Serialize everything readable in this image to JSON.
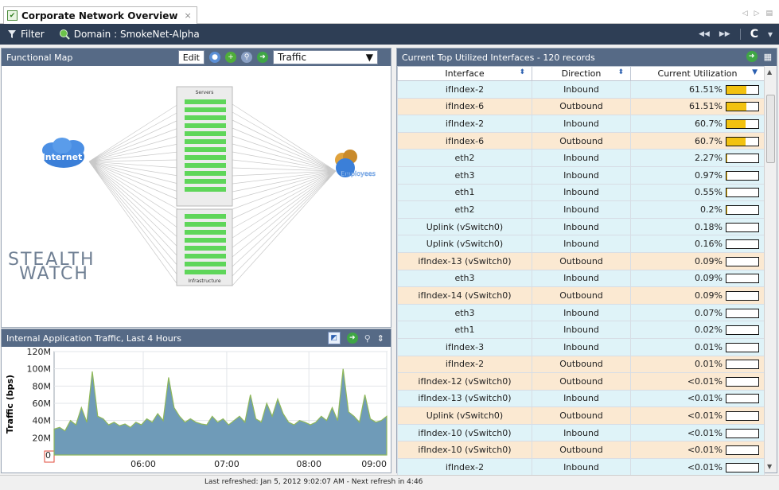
{
  "tab": {
    "title": "Corporate Network Overview",
    "close": "×",
    "nav_glyphs": [
      "◁",
      "▷",
      "▤"
    ]
  },
  "toolbar": {
    "filter_label": "Filter",
    "domain_label": "Domain : SmokeNet-Alpha",
    "nav_back": "◀◀",
    "nav_forward": "▶▶",
    "refresh": "C",
    "menu": "▾"
  },
  "functional_map": {
    "title": "Functional Map",
    "edit_label": "Edit",
    "view_select": "Traffic",
    "nodes": {
      "internet": "Internet",
      "employees": "Employees",
      "servers": "Servers",
      "infrastructure": "Infrastructure"
    },
    "logo": {
      "line1": "STEALTH",
      "line2": "WATCH"
    }
  },
  "traffic_chart": {
    "title": "Internal Application Traffic, Last 4 Hours",
    "colors": {
      "fill": "#6f9bb8",
      "spikes": "#8fb85a",
      "axis_box": "#e04a3a"
    }
  },
  "chart_data": {
    "type": "area",
    "ylabel": "Traffic (bps)",
    "yticks": [
      "0",
      "20M",
      "40M",
      "60M",
      "80M",
      "100M",
      "120M"
    ],
    "ylim": [
      0,
      120000000
    ],
    "xticks": [
      "06:00",
      "07:00",
      "08:00",
      "09:00"
    ],
    "series": [
      {
        "values": [
          30000000,
          32000000,
          28000000,
          40000000,
          35000000,
          55000000,
          38000000,
          97000000,
          45000000,
          42000000,
          35000000,
          38000000,
          34000000,
          36000000,
          32000000,
          38000000,
          35000000,
          42000000,
          38000000,
          48000000,
          40000000,
          90000000,
          55000000,
          45000000,
          38000000,
          42000000,
          38000000,
          36000000,
          35000000,
          45000000,
          38000000,
          42000000,
          35000000,
          40000000,
          45000000,
          38000000,
          70000000,
          42000000,
          38000000,
          60000000,
          45000000,
          65000000,
          48000000,
          38000000,
          35000000,
          40000000,
          38000000,
          35000000,
          38000000,
          45000000,
          40000000,
          55000000,
          40000000,
          100000000,
          50000000,
          45000000,
          38000000,
          70000000,
          42000000,
          38000000,
          40000000,
          45000000
        ]
      }
    ],
    "grid": true
  },
  "interfaces_table": {
    "title": "Current Top Utilized Interfaces - 120 records",
    "columns": [
      "Interface",
      "Direction",
      "Current Utilization"
    ],
    "rows": [
      {
        "interface": "ifIndex-2",
        "direction": "Inbound",
        "util": "61.51%",
        "pct": 61.51
      },
      {
        "interface": "ifIndex-6",
        "direction": "Outbound",
        "util": "61.51%",
        "pct": 61.51
      },
      {
        "interface": "ifIndex-2",
        "direction": "Inbound",
        "util": "60.7%",
        "pct": 60.7
      },
      {
        "interface": "ifIndex-6",
        "direction": "Outbound",
        "util": "60.7%",
        "pct": 60.7
      },
      {
        "interface": "eth2",
        "direction": "Inbound",
        "util": "2.27%",
        "pct": 2.27
      },
      {
        "interface": "eth3",
        "direction": "Inbound",
        "util": "0.97%",
        "pct": 0.97
      },
      {
        "interface": "eth1",
        "direction": "Inbound",
        "util": "0.55%",
        "pct": 0.55
      },
      {
        "interface": "eth2",
        "direction": "Inbound",
        "util": "0.2%",
        "pct": 0.2
      },
      {
        "interface": "Uplink (vSwitch0)",
        "direction": "Inbound",
        "util": "0.18%",
        "pct": 0.18
      },
      {
        "interface": "Uplink (vSwitch0)",
        "direction": "Inbound",
        "util": "0.16%",
        "pct": 0.16
      },
      {
        "interface": "ifIndex-13 (vSwitch0)",
        "direction": "Outbound",
        "util": "0.09%",
        "pct": 0.09
      },
      {
        "interface": "eth3",
        "direction": "Inbound",
        "util": "0.09%",
        "pct": 0.09
      },
      {
        "interface": "ifIndex-14 (vSwitch0)",
        "direction": "Outbound",
        "util": "0.09%",
        "pct": 0.09
      },
      {
        "interface": "eth3",
        "direction": "Inbound",
        "util": "0.07%",
        "pct": 0.07
      },
      {
        "interface": "eth1",
        "direction": "Inbound",
        "util": "0.02%",
        "pct": 0.02
      },
      {
        "interface": "ifIndex-3",
        "direction": "Inbound",
        "util": "0.01%",
        "pct": 0.01
      },
      {
        "interface": "ifIndex-2",
        "direction": "Outbound",
        "util": "0.01%",
        "pct": 0.01
      },
      {
        "interface": "ifIndex-12 (vSwitch0)",
        "direction": "Outbound",
        "util": "<0.01%",
        "pct": 0
      },
      {
        "interface": "ifIndex-13 (vSwitch0)",
        "direction": "Inbound",
        "util": "<0.01%",
        "pct": 0
      },
      {
        "interface": "Uplink (vSwitch0)",
        "direction": "Outbound",
        "util": "<0.01%",
        "pct": 0
      },
      {
        "interface": "ifIndex-10 (vSwitch0)",
        "direction": "Inbound",
        "util": "<0.01%",
        "pct": 0
      },
      {
        "interface": "ifIndex-10 (vSwitch0)",
        "direction": "Outbound",
        "util": "<0.01%",
        "pct": 0
      },
      {
        "interface": "ifIndex-2",
        "direction": "Inbound",
        "util": "<0.01%",
        "pct": 0
      }
    ]
  },
  "status": {
    "text": "Last refreshed: Jan 5, 2012 9:02:07 AM - Next refresh in 4:46"
  }
}
